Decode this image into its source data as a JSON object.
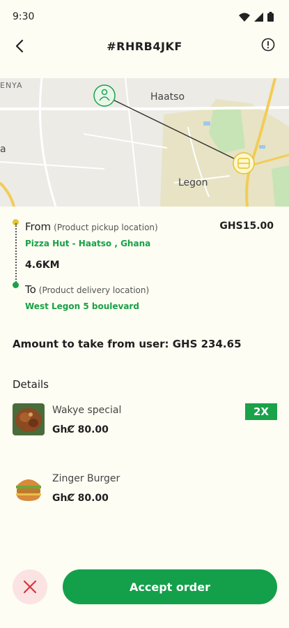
{
  "status_bar": {
    "time": "9:30"
  },
  "header": {
    "title": "#RHRB4JKF",
    "back_icon": "chevron-left-icon",
    "info_icon": "info-icon"
  },
  "map": {
    "labels": {
      "top_left": "ENYA",
      "haatso": "Haatso",
      "legon": "Legon",
      "left_edge": "a"
    }
  },
  "route": {
    "from_label": "From",
    "from_hint": "(Product pickup location)",
    "from_place": "Pizza Hut - Haatso , Ghana",
    "price": "GHS15.00",
    "distance": "4.6KM",
    "to_label": "To",
    "to_hint": "(Product delivery location)",
    "to_place": "West Legon 5 boulevard"
  },
  "amount_text": "Amount to take from user: GHS 234.65",
  "details": {
    "title": "Details",
    "items": [
      {
        "name": "Wakye special",
        "price": "GhȻ 80.00",
        "qty": "2X"
      },
      {
        "name": "Zinger Burger",
        "price": "GhȻ 80.00"
      }
    ]
  },
  "actions": {
    "accept_label": "Accept order",
    "reject_icon": "close-icon"
  },
  "colors": {
    "accent_green": "#14a04a",
    "background": "#fdfdf3",
    "reject_bg": "#fbe3e3",
    "reject_x": "#d9343a"
  }
}
